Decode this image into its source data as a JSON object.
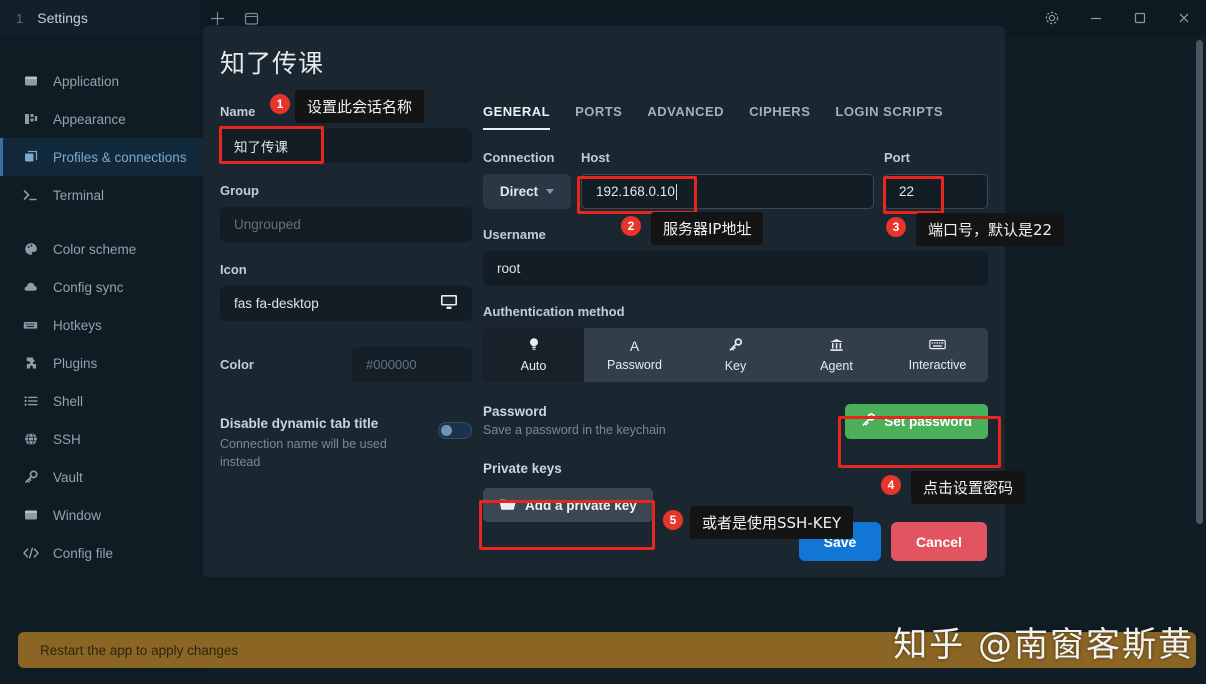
{
  "titlebar": {
    "tab_index": "1",
    "tab_title": "Settings",
    "new_tab_icon": "plus-icon",
    "split_icon": "split-pane-icon",
    "settings_icon": "gear-icon",
    "minimize_icon": "minimize-icon",
    "maximize_icon": "maximize-icon",
    "close_icon": "close-icon"
  },
  "sidebar": {
    "items": [
      {
        "label": "Application",
        "icon": "window-icon",
        "active": false
      },
      {
        "label": "Appearance",
        "icon": "palette-swatch-icon",
        "active": false
      },
      {
        "label": "Profiles & connections",
        "icon": "layers-icon",
        "active": true
      },
      {
        "label": "Terminal",
        "icon": "terminal-prompt-icon",
        "active": false
      },
      {
        "label": "Color scheme",
        "icon": "palette-icon",
        "active": false
      },
      {
        "label": "Config sync",
        "icon": "cloud-icon",
        "active": false
      },
      {
        "label": "Hotkeys",
        "icon": "keyboard-icon",
        "active": false
      },
      {
        "label": "Plugins",
        "icon": "puzzle-icon",
        "active": false
      },
      {
        "label": "Shell",
        "icon": "list-icon",
        "active": false
      },
      {
        "label": "SSH",
        "icon": "globe-icon",
        "active": false
      },
      {
        "label": "Vault",
        "icon": "key-icon",
        "active": false
      },
      {
        "label": "Window",
        "icon": "window-icon",
        "active": false
      },
      {
        "label": "Config file",
        "icon": "code-icon",
        "active": false
      }
    ]
  },
  "statusbar": {
    "message": "Restart the app to apply changes",
    "color": "#8a6524"
  },
  "dialog": {
    "title": "知了传课",
    "left": {
      "name_label": "Name",
      "name_value": "知了传课",
      "group_label": "Group",
      "group_placeholder": "Ungrouped",
      "icon_label": "Icon",
      "icon_value": "fas fa-desktop",
      "icon_preview": "desktop-icon",
      "color_label": "Color",
      "color_placeholder": "#000000",
      "toggle_title": "Disable dynamic tab title",
      "toggle_sub": "Connection name will be used instead",
      "toggle_on": false
    },
    "tabs": [
      {
        "label": "GENERAL",
        "active": true
      },
      {
        "label": "PORTS",
        "active": false
      },
      {
        "label": "ADVANCED",
        "active": false
      },
      {
        "label": "CIPHERS",
        "active": false
      },
      {
        "label": "LOGIN SCRIPTS",
        "active": false
      }
    ],
    "general": {
      "connection_label": "Connection",
      "connection_value": "Direct",
      "host_label": "Host",
      "host_value": "192.168.0.10",
      "port_label": "Port",
      "port_value": "22",
      "username_label": "Username",
      "username_value": "root",
      "auth_label": "Authentication method",
      "auth_methods": [
        {
          "label": "Auto",
          "icon": "bulb-icon",
          "glyph": "○",
          "active": true
        },
        {
          "label": "Password",
          "icon": "letter-a-icon",
          "glyph": "A",
          "active": false
        },
        {
          "label": "Key",
          "icon": "key-icon",
          "glyph": "⚷",
          "active": false
        },
        {
          "label": "Agent",
          "icon": "agent-icon",
          "glyph": "♜",
          "active": false
        },
        {
          "label": "Interactive",
          "icon": "keyboard-icon",
          "glyph": "⌨",
          "active": false
        }
      ],
      "password_title": "Password",
      "password_sub": "Save a password in the keychain",
      "set_password_label": "Set password",
      "set_password_icon": "key-icon",
      "set_password_color": "#4caf5a",
      "private_keys_title": "Private keys",
      "add_key_label": "Add a private key",
      "add_key_icon": "folder-open-icon"
    },
    "footer": {
      "save_label": "Save",
      "save_color": "#1277d4",
      "cancel_label": "Cancel",
      "cancel_color": "#e15460"
    }
  },
  "annotations": [
    {
      "number": "1",
      "text": "设置此会话名称"
    },
    {
      "number": "2",
      "text": "服务器IP地址"
    },
    {
      "number": "3",
      "text": "端口号，默认是22"
    },
    {
      "number": "4",
      "text": "点击设置密码"
    },
    {
      "number": "5",
      "text": "或者是使用SSH-KEY"
    }
  ],
  "watermark": "知乎 @南窗客斯黄"
}
